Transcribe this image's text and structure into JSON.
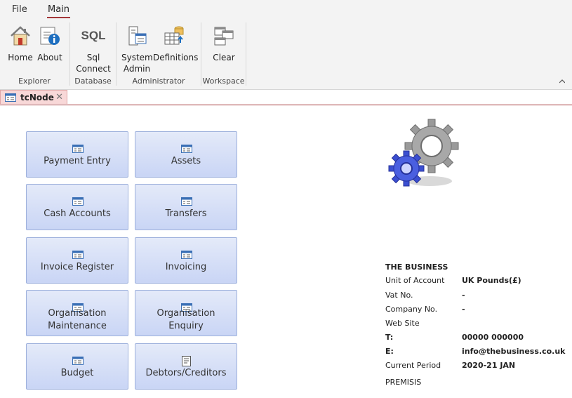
{
  "menu": {
    "file": "File",
    "main": "Main"
  },
  "ribbon": {
    "groups": [
      {
        "label": "Explorer"
      },
      {
        "label": "Database"
      },
      {
        "label": "Administrator"
      },
      {
        "label": "Workspace"
      }
    ],
    "buttons": {
      "home": "Home",
      "about": "About",
      "sql_line1": "Sql",
      "sql_line2": "Connect",
      "sql_icon_text": "SQL",
      "sysadmin_line1": "System",
      "sysadmin_line2": "Admin",
      "definitions": "Definitions",
      "clear": "Clear"
    }
  },
  "tab": {
    "title": "tcNode"
  },
  "nav": {
    "payment_entry": "Payment Entry",
    "assets": "Assets",
    "cash_accounts": "Cash Accounts",
    "transfers": "Transfers",
    "invoice_register": "Invoice Register",
    "invoicing": "Invoicing",
    "org_maintenance_1": "Organisation",
    "org_maintenance_2": "Maintenance",
    "org_enquiry_1": "Organisation",
    "org_enquiry_2": "Enquiry",
    "budget": "Budget",
    "debtors_creditors": "Debtors/Creditors"
  },
  "business": {
    "name": "THE BUSINESS",
    "unit_label": "Unit of Account",
    "unit_value": "UK Pounds(£)",
    "vat_label": "Vat No.",
    "vat_value": "-",
    "company_label": "Company No.",
    "company_value": "-",
    "website_label": "Web Site",
    "phone_label": "T:",
    "phone_value": "00000 000000",
    "email_label": "E:",
    "email_value": "info@thebusiness.co.uk",
    "period_label": "Current Period",
    "period_value": "2020-21 JAN",
    "premisis": "PREMISIS"
  }
}
